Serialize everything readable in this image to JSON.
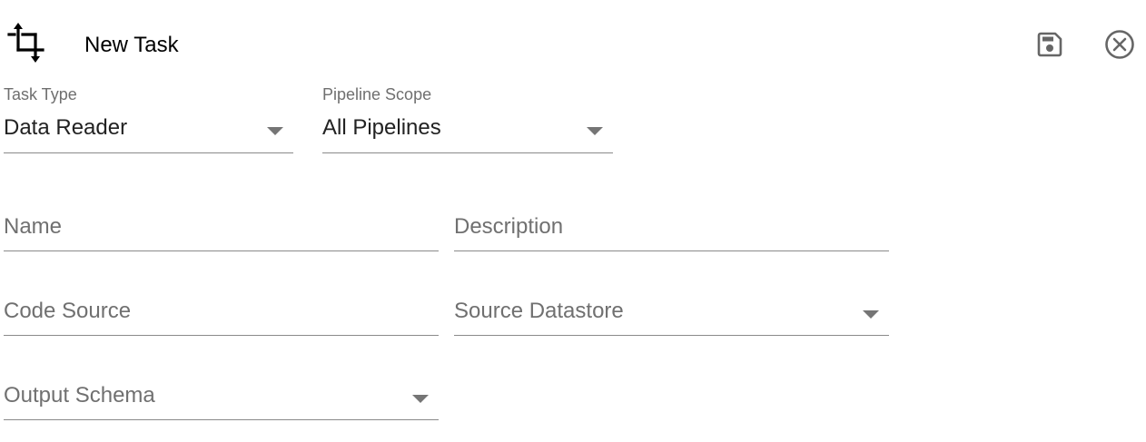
{
  "header": {
    "title": "New Task",
    "icons": {
      "task": "crop-icon",
      "save": "save-icon",
      "close": "close-circle-icon"
    }
  },
  "form": {
    "task_type": {
      "label": "Task Type",
      "value": "Data Reader"
    },
    "pipeline_scope": {
      "label": "Pipeline Scope",
      "value": "All Pipelines"
    },
    "name": {
      "placeholder": "Name"
    },
    "description": {
      "placeholder": "Description"
    },
    "code_source": {
      "placeholder": "Code Source"
    },
    "source_datastore": {
      "placeholder": "Source Datastore"
    },
    "output_schema": {
      "placeholder": "Output Schema"
    }
  }
}
